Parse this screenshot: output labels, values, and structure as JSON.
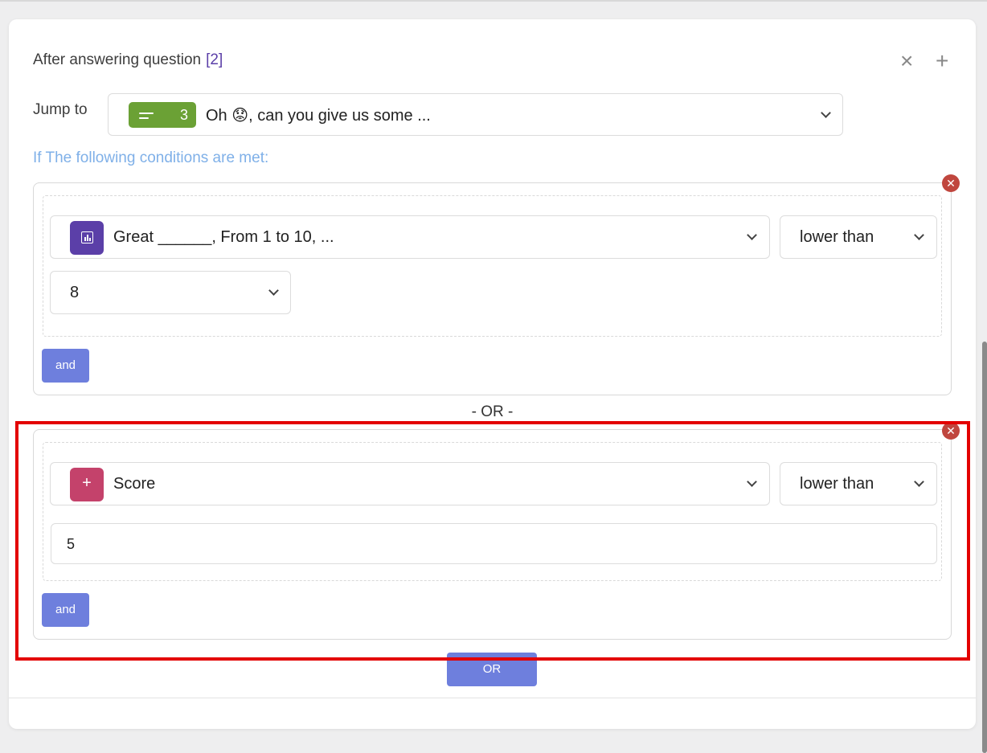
{
  "header": {
    "title": "After answering question",
    "question_ref": "[2]"
  },
  "icons": {
    "close": "close-icon",
    "add": "plus-icon"
  },
  "jump": {
    "label": "Jump to",
    "badge_number": "3",
    "target_text": "Oh 😟, can you give us some ..."
  },
  "conditions_label": "If The following conditions are met:",
  "groups": [
    {
      "field": "Great ______, From 1 to 10, ...",
      "operator": "lower than",
      "value": "8",
      "and_label": "and"
    },
    {
      "field": "Score",
      "operator": "lower than",
      "value": "5",
      "and_label": "and"
    }
  ],
  "or_separator": "- OR -",
  "or_button": "OR",
  "colors": {
    "accent_button": "#6e7fdd",
    "badge_green": "#6ba135",
    "rating_icon": "#5b3fa8",
    "score_icon": "#c4426b",
    "remove": "#c0463e",
    "highlight": "#e30000",
    "conditions_label": "#7fb0e8"
  }
}
